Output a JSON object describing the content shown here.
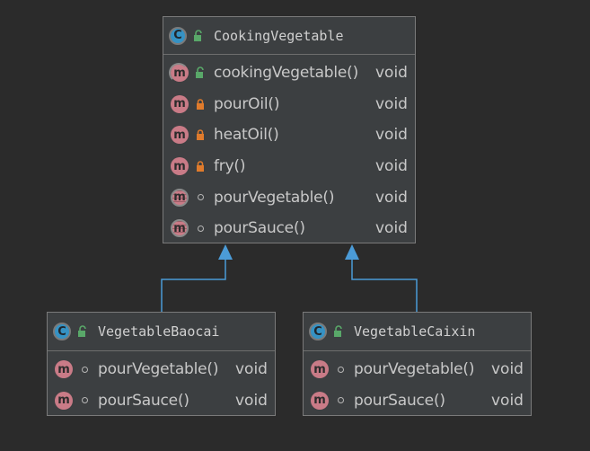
{
  "colors": {
    "background": "#2b2b2b",
    "class_fill": "#3c3f41",
    "class_border": "#7a7a7a",
    "class_badge": "#3592c4",
    "method_badge": "#c97b87",
    "public_lock": "#59a869",
    "private_lock": "#e07b2c",
    "arrow": "#4b9bd7",
    "text": "#c8c8c8"
  },
  "diagram": {
    "classes": [
      {
        "name": "CookingVegetable",
        "class_icon": "C",
        "visibility": "public",
        "members": [
          {
            "badge": "m",
            "style": "abstract",
            "visibility": "public",
            "name": "cookingVegetable()",
            "type": "void"
          },
          {
            "badge": "m",
            "style": "normal",
            "visibility": "private",
            "name": "pourOil()",
            "type": "void"
          },
          {
            "badge": "m",
            "style": "normal",
            "visibility": "private",
            "name": "heatOil()",
            "type": "void"
          },
          {
            "badge": "m",
            "style": "normal",
            "visibility": "private",
            "name": "fry()",
            "type": "void"
          },
          {
            "badge": "m",
            "style": "striped",
            "visibility": "package",
            "name": "pourVegetable()",
            "type": "void"
          },
          {
            "badge": "m",
            "style": "striped",
            "visibility": "package",
            "name": "pourSauce()",
            "type": "void"
          }
        ]
      },
      {
        "name": "VegetableBaocai",
        "class_icon": "C",
        "visibility": "public",
        "members": [
          {
            "badge": "m",
            "style": "normal",
            "visibility": "package",
            "name": "pourVegetable()",
            "type": "void"
          },
          {
            "badge": "m",
            "style": "normal",
            "visibility": "package",
            "name": "pourSauce()",
            "type": "void"
          }
        ]
      },
      {
        "name": "VegetableCaixin",
        "class_icon": "C",
        "visibility": "public",
        "members": [
          {
            "badge": "m",
            "style": "normal",
            "visibility": "package",
            "name": "pourVegetable()",
            "type": "void"
          },
          {
            "badge": "m",
            "style": "normal",
            "visibility": "package",
            "name": "pourSauce()",
            "type": "void"
          }
        ]
      }
    ],
    "relations": [
      {
        "type": "inheritance",
        "from": "VegetableBaocai",
        "to": "CookingVegetable"
      },
      {
        "type": "inheritance",
        "from": "VegetableCaixin",
        "to": "CookingVegetable"
      }
    ]
  }
}
